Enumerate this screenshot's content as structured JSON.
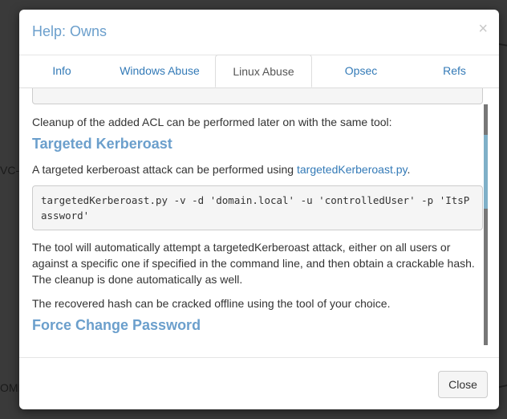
{
  "background": {
    "text_left": "VC-A",
    "text_bottom": "OMIN"
  },
  "modal": {
    "title": "Help: Owns",
    "close_glyph": "×"
  },
  "tabs": [
    {
      "label": "Info",
      "active": false
    },
    {
      "label": "Windows Abuse",
      "active": false
    },
    {
      "label": "Linux Abuse",
      "active": true
    },
    {
      "label": "Opsec",
      "active": false
    },
    {
      "label": "Refs",
      "active": false
    }
  ],
  "content": {
    "cleanup_text": "Cleanup of the added ACL can be performed later on with the same tool:",
    "heading_targeted": "Targeted Kerberoast",
    "targeted_intro": "A targeted kerberoast attack can be performed using ",
    "targeted_link": "targetedKerberoast.py",
    "targeted_period": ".",
    "code": "targetedKerberoast.py -v -d 'domain.local' -u 'controlledUser' -p 'ItsPassword'",
    "auto_text": "The tool will automatically attempt a targetedKerberoast attack, either on all users or against a specific one if specified in the command line, and then obtain a crackable hash. The cleanup is done automatically as well.",
    "recovered_text": "The recovered hash can be cracked offline using the tool of your choice.",
    "heading_force": "Force Change Password"
  },
  "footer": {
    "close_label": "Close"
  },
  "colors": {
    "accent": "#6b9fcc",
    "link": "#337ab7"
  }
}
